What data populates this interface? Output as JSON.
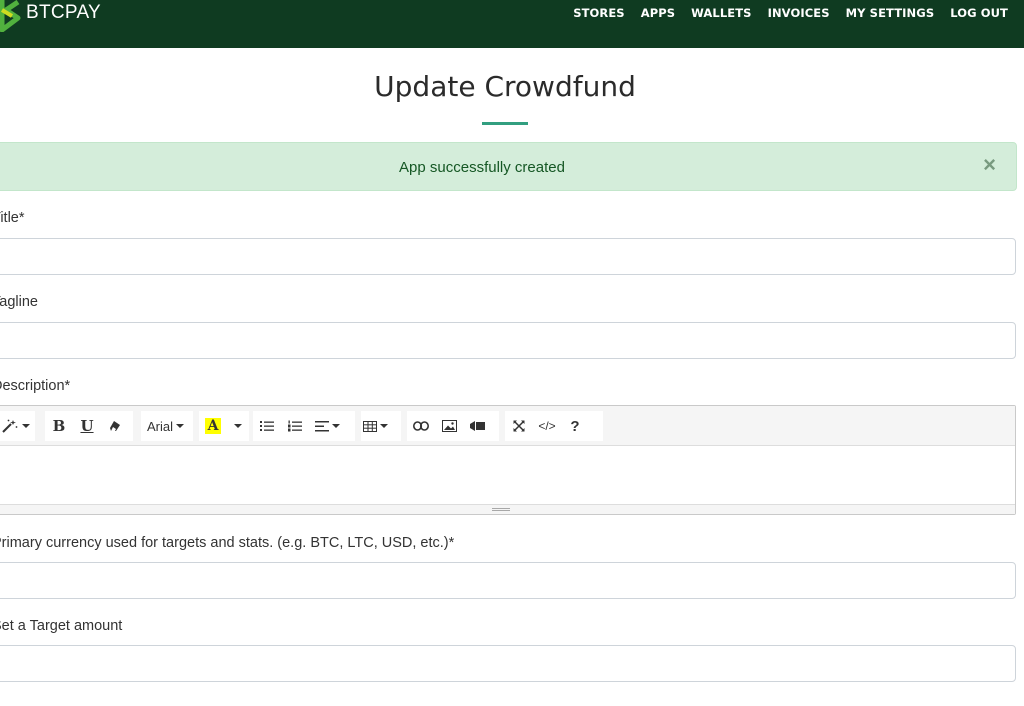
{
  "brand": {
    "name": "BTCPAY"
  },
  "nav": {
    "stores": "Stores",
    "apps": "Apps",
    "wallets": "Wallets",
    "invoices": "Invoices",
    "my_settings": "My Settings",
    "log_out": "Log out"
  },
  "page": {
    "title": "Update Crowdfund"
  },
  "alert": {
    "message": "App successfully created",
    "close": "×"
  },
  "form": {
    "title_label": "Title*",
    "title_value": "",
    "tagline_label": "Tagline",
    "tagline_value": "",
    "description_label": "Description*",
    "currency_label": "Primary currency used for targets and stats. (e.g. BTC, LTC, USD, etc.)*",
    "currency_value": "",
    "target_label": "Set a Target amount",
    "target_value": ""
  },
  "editor": {
    "bold": "B",
    "underline": "U",
    "font_name": "Arial",
    "highlight_letter": "A",
    "help": "?",
    "code": "</>"
  },
  "colors": {
    "navbar": "#0f3b21",
    "accent": "#329f80",
    "alert_bg": "#d4edda",
    "alert_text": "#155724",
    "highlight": "#ffff00"
  }
}
